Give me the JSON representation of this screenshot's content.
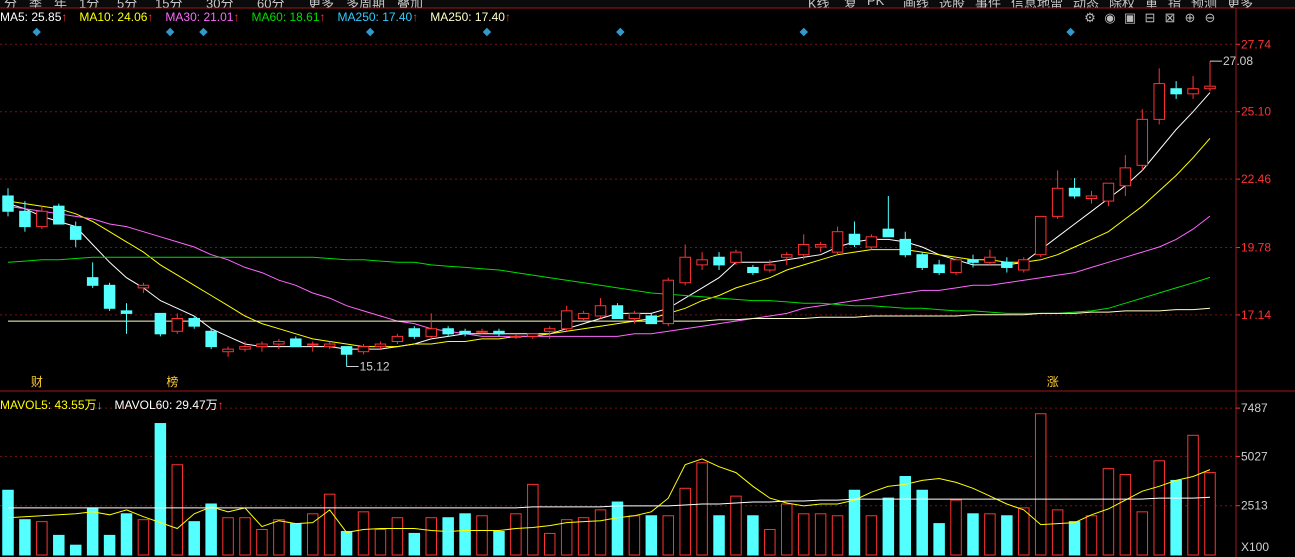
{
  "toolbar": {
    "left_items": [
      "分",
      "季",
      "年",
      "1分",
      "5分",
      "15分",
      "30分",
      "60分",
      "更多",
      "多周期",
      "叠加"
    ],
    "right_items": [
      "K线",
      "复",
      "PK",
      "画线",
      "选股",
      "事件",
      "信息地雷",
      "动态",
      "除权",
      "重",
      "指",
      "预测",
      "更多"
    ]
  },
  "ma_legend": [
    {
      "label": "MA5: 25.85",
      "arrow": "↑",
      "color": "#ffffff"
    },
    {
      "label": "MA10: 24.06",
      "arrow": "↑",
      "color": "#ffff00"
    },
    {
      "label": "MA30: 21.01",
      "arrow": "↑",
      "color": "#ff66ff"
    },
    {
      "label": "MA60: 18.61",
      "arrow": "↑",
      "color": "#00dd00"
    },
    {
      "label": "MA250: 17.40",
      "arrow": "↑",
      "color": "#33ccff"
    },
    {
      "label": "MA250: 17.40",
      "arrow": "↑",
      "color": "#ffffc8"
    }
  ],
  "vol_legend": [
    {
      "label": "MAVOL5: 43.55万",
      "arrow": "↓",
      "color": "#ffff00",
      "arrow_color": "#33ccff"
    },
    {
      "label": "MAVOL60: 29.47万",
      "arrow": "↑",
      "color": "#ffffff",
      "arrow_color": "#ff3232"
    }
  ],
  "icons": [
    "settings-icon",
    "eye-icon",
    "lock-icon",
    "bag-icon",
    "trash-icon",
    "zoom-in-icon",
    "zoom-out-icon"
  ],
  "colors": {
    "up": "#ff3232",
    "down": "#54ffff",
    "grid": "#7a1212",
    "axis_text": "#ff3232"
  },
  "chart_data": [
    {
      "type": "candlestick",
      "yticks": [
        "27.74",
        "25.10",
        "22.46",
        "19.78",
        "17.14"
      ],
      "ylim": [
        14.2,
        28.3
      ],
      "grid": true,
      "annotations": {
        "high": {
          "text": "27.08",
          "index": 71
        },
        "low": {
          "text": "15.12",
          "index": 20
        },
        "markers": [
          {
            "text": "财",
            "index": 1
          },
          {
            "text": "榜",
            "index": 9
          },
          {
            "text": "涨",
            "index": 61
          }
        ],
        "event_diamonds": [
          1,
          9,
          11,
          21,
          28,
          36,
          47,
          63
        ]
      },
      "ohlc": [
        [
          21.8,
          22.1,
          21.0,
          21.2
        ],
        [
          21.2,
          21.6,
          20.4,
          20.6
        ],
        [
          20.6,
          21.4,
          20.5,
          21.2
        ],
        [
          21.4,
          21.5,
          20.7,
          20.7
        ],
        [
          20.6,
          20.8,
          19.8,
          20.1
        ],
        [
          18.6,
          19.2,
          18.2,
          18.3
        ],
        [
          18.3,
          18.4,
          17.3,
          17.4
        ],
        [
          17.3,
          17.6,
          16.4,
          17.2
        ],
        [
          18.2,
          18.4,
          18.0,
          18.3
        ],
        [
          17.2,
          17.2,
          16.3,
          16.4
        ],
        [
          16.5,
          17.2,
          16.4,
          17.0
        ],
        [
          17.0,
          17.1,
          16.6,
          16.7
        ],
        [
          16.5,
          16.6,
          15.8,
          15.9
        ],
        [
          15.7,
          15.9,
          15.5,
          15.8
        ],
        [
          15.8,
          16.1,
          15.7,
          15.9
        ],
        [
          15.9,
          16.1,
          15.7,
          16.0
        ],
        [
          16.0,
          16.2,
          15.8,
          16.1
        ],
        [
          16.2,
          16.3,
          15.9,
          15.9
        ],
        [
          16.0,
          16.1,
          15.7,
          16.0
        ],
        [
          15.9,
          16.1,
          15.8,
          16.0
        ],
        [
          15.9,
          15.9,
          15.12,
          15.6
        ],
        [
          15.7,
          16.0,
          15.6,
          15.9
        ],
        [
          15.9,
          16.1,
          15.8,
          16.0
        ],
        [
          16.1,
          16.4,
          16.0,
          16.3
        ],
        [
          16.6,
          16.7,
          16.2,
          16.3
        ],
        [
          16.3,
          17.2,
          16.2,
          16.6
        ],
        [
          16.6,
          16.7,
          16.3,
          16.4
        ],
        [
          16.5,
          16.6,
          16.3,
          16.4
        ],
        [
          16.5,
          16.6,
          16.4,
          16.5
        ],
        [
          16.5,
          16.6,
          16.3,
          16.4
        ],
        [
          16.3,
          16.4,
          16.2,
          16.3
        ],
        [
          16.3,
          16.4,
          16.2,
          16.4
        ],
        [
          16.5,
          16.7,
          16.2,
          16.6
        ],
        [
          16.6,
          17.5,
          16.5,
          17.3
        ],
        [
          17.0,
          17.3,
          16.9,
          17.2
        ],
        [
          17.1,
          17.8,
          17.0,
          17.5
        ],
        [
          17.5,
          17.6,
          17.0,
          17.0
        ],
        [
          17.0,
          17.3,
          16.8,
          17.2
        ],
        [
          17.1,
          17.2,
          16.8,
          16.8
        ],
        [
          16.8,
          18.6,
          16.7,
          18.5
        ],
        [
          18.4,
          19.9,
          18.3,
          19.4
        ],
        [
          19.1,
          19.6,
          18.9,
          19.3
        ],
        [
          19.4,
          19.6,
          18.9,
          19.1
        ],
        [
          19.2,
          19.7,
          19.1,
          19.6
        ],
        [
          19.0,
          19.1,
          18.7,
          18.8
        ],
        [
          18.9,
          19.3,
          18.8,
          19.1
        ],
        [
          19.4,
          19.6,
          19.1,
          19.5
        ],
        [
          19.5,
          20.3,
          19.3,
          19.9
        ],
        [
          19.8,
          20.0,
          19.6,
          19.9
        ],
        [
          19.6,
          20.6,
          19.5,
          20.4
        ],
        [
          20.3,
          20.8,
          19.8,
          19.9
        ],
        [
          19.8,
          20.3,
          19.7,
          20.2
        ],
        [
          20.5,
          21.8,
          20.2,
          20.2
        ],
        [
          20.1,
          20.4,
          19.4,
          19.5
        ],
        [
          19.5,
          19.6,
          18.9,
          19.0
        ],
        [
          19.1,
          19.3,
          18.7,
          18.8
        ],
        [
          18.8,
          19.4,
          18.7,
          19.3
        ],
        [
          19.3,
          19.5,
          19.0,
          19.2
        ],
        [
          19.2,
          19.7,
          19.1,
          19.4
        ],
        [
          19.2,
          19.4,
          18.8,
          19.0
        ],
        [
          18.9,
          19.4,
          18.8,
          19.3
        ],
        [
          19.5,
          21.0,
          19.4,
          21.0
        ],
        [
          21.0,
          22.8,
          20.9,
          22.1
        ],
        [
          22.1,
          22.5,
          21.7,
          21.8
        ],
        [
          21.7,
          22.0,
          21.5,
          21.8
        ],
        [
          21.6,
          22.3,
          21.4,
          22.3
        ],
        [
          22.2,
          23.4,
          21.8,
          22.9
        ],
        [
          23.0,
          25.2,
          22.8,
          24.8
        ],
        [
          24.8,
          26.8,
          24.6,
          26.2
        ],
        [
          26.0,
          26.3,
          25.6,
          25.8
        ],
        [
          25.8,
          26.5,
          25.6,
          26.0
        ],
        [
          26.0,
          27.08,
          25.9,
          26.1
        ]
      ],
      "ma": {
        "MA5": [
          21.5,
          21.3,
          21.0,
          20.8,
          20.6,
          19.9,
          19.2,
          18.6,
          18.2,
          17.7,
          17.4,
          17.1,
          16.6,
          16.3,
          16.0,
          15.9,
          15.9,
          15.9,
          15.9,
          15.9,
          15.8,
          15.8,
          15.8,
          15.9,
          16.0,
          16.2,
          16.3,
          16.4,
          16.4,
          16.4,
          16.4,
          16.4,
          16.4,
          16.6,
          16.8,
          17.0,
          17.2,
          17.2,
          17.2,
          17.4,
          17.8,
          18.2,
          18.6,
          19.2,
          19.2,
          19.2,
          19.3,
          19.4,
          19.5,
          19.8,
          20.0,
          20.1,
          20.1,
          20.0,
          19.8,
          19.5,
          19.3,
          19.1,
          19.1,
          19.1,
          19.2,
          19.7,
          20.2,
          20.7,
          21.2,
          21.7,
          22.2,
          22.8,
          23.6,
          24.4,
          25.1,
          25.85
        ],
        "MA10": [
          21.6,
          21.5,
          21.4,
          21.3,
          21.1,
          20.8,
          20.4,
          20.0,
          19.6,
          19.1,
          18.7,
          18.3,
          17.9,
          17.5,
          17.1,
          16.8,
          16.6,
          16.4,
          16.2,
          16.1,
          16.0,
          15.9,
          15.9,
          15.9,
          16.0,
          16.0,
          16.1,
          16.1,
          16.2,
          16.2,
          16.3,
          16.3,
          16.4,
          16.5,
          16.6,
          16.7,
          16.8,
          16.9,
          17.0,
          17.2,
          17.4,
          17.7,
          17.9,
          18.2,
          18.4,
          18.6,
          18.9,
          19.1,
          19.3,
          19.5,
          19.6,
          19.7,
          19.7,
          19.7,
          19.6,
          19.5,
          19.4,
          19.3,
          19.3,
          19.2,
          19.2,
          19.3,
          19.5,
          19.8,
          20.1,
          20.4,
          20.9,
          21.4,
          22.0,
          22.6,
          23.3,
          24.06
        ],
        "MA30": [
          21.4,
          21.3,
          21.2,
          21.1,
          21.0,
          20.9,
          20.7,
          20.6,
          20.4,
          20.2,
          20.0,
          19.8,
          19.5,
          19.3,
          19.0,
          18.8,
          18.5,
          18.3,
          18.0,
          17.8,
          17.5,
          17.3,
          17.1,
          16.9,
          16.8,
          16.6,
          16.5,
          16.4,
          16.3,
          16.3,
          16.3,
          16.3,
          16.3,
          16.3,
          16.3,
          16.3,
          16.3,
          16.4,
          16.4,
          16.5,
          16.6,
          16.7,
          16.8,
          16.9,
          17.0,
          17.1,
          17.2,
          17.4,
          17.5,
          17.6,
          17.7,
          17.8,
          17.9,
          18.0,
          18.1,
          18.1,
          18.2,
          18.3,
          18.3,
          18.4,
          18.5,
          18.6,
          18.7,
          18.8,
          19.0,
          19.2,
          19.4,
          19.6,
          19.8,
          20.1,
          20.5,
          21.01
        ],
        "MA60": [
          19.2,
          19.25,
          19.3,
          19.3,
          19.35,
          19.4,
          19.4,
          19.4,
          19.4,
          19.4,
          19.4,
          19.4,
          19.4,
          19.4,
          19.4,
          19.4,
          19.4,
          19.4,
          19.4,
          19.35,
          19.3,
          19.3,
          19.25,
          19.2,
          19.2,
          19.1,
          19.05,
          19.0,
          18.95,
          18.9,
          18.8,
          18.7,
          18.6,
          18.5,
          18.4,
          18.3,
          18.2,
          18.1,
          18.0,
          17.95,
          17.9,
          17.85,
          17.8,
          17.75,
          17.7,
          17.7,
          17.65,
          17.6,
          17.6,
          17.55,
          17.5,
          17.5,
          17.45,
          17.4,
          17.4,
          17.35,
          17.3,
          17.3,
          17.25,
          17.2,
          17.2,
          17.2,
          17.2,
          17.25,
          17.3,
          17.4,
          17.6,
          17.8,
          18.0,
          18.2,
          18.4,
          18.61
        ],
        "MA250": [
          16.9,
          16.9,
          16.9,
          16.9,
          16.9,
          16.9,
          16.9,
          16.9,
          16.9,
          16.9,
          16.9,
          16.9,
          16.9,
          16.9,
          16.9,
          16.9,
          16.9,
          16.9,
          16.9,
          16.9,
          16.9,
          16.9,
          16.9,
          16.9,
          16.9,
          16.9,
          16.9,
          16.9,
          16.9,
          16.9,
          16.9,
          16.9,
          16.9,
          16.9,
          16.9,
          16.9,
          16.9,
          16.9,
          16.9,
          16.9,
          16.9,
          16.9,
          16.95,
          16.95,
          17.0,
          17.0,
          17.0,
          17.0,
          17.05,
          17.05,
          17.05,
          17.1,
          17.1,
          17.1,
          17.1,
          17.1,
          17.1,
          17.15,
          17.15,
          17.15,
          17.15,
          17.2,
          17.2,
          17.2,
          17.25,
          17.25,
          17.3,
          17.3,
          17.3,
          17.35,
          17.35,
          17.4
        ]
      }
    },
    {
      "type": "bar",
      "yticks": [
        "7487",
        "5027",
        "2513"
      ],
      "unit": "X100",
      "ylim": [
        0,
        7900
      ],
      "volume": [
        3300,
        1800,
        1700,
        1000,
        500,
        2400,
        1000,
        2100,
        1800,
        6700,
        4600,
        1700,
        2600,
        1900,
        1900,
        1300,
        1800,
        1600,
        2100,
        3100,
        1200,
        2200,
        1300,
        1900,
        1100,
        1900,
        1900,
        2100,
        2000,
        1200,
        2100,
        3600,
        1100,
        1800,
        1900,
        2300,
        2700,
        2000,
        2000,
        2000,
        3400,
        4700,
        2000,
        3000,
        2000,
        1300,
        2600,
        2100,
        2100,
        2000,
        3300,
        2000,
        2900,
        4000,
        3300,
        1600,
        2800,
        2100,
        2100,
        2000,
        2400,
        7200,
        2300,
        1700,
        2000,
        4400,
        4100,
        2200,
        4800,
        3800,
        6100,
        4200
      ],
      "mavol5": [
        1900,
        1950,
        2000,
        2050,
        2100,
        2200,
        2050,
        2300,
        1950,
        1650,
        1350,
        2100,
        2450,
        2200,
        2400,
        1450,
        1750,
        1600,
        1650,
        2300,
        1150,
        1300,
        1350,
        1350,
        1350,
        1250,
        1200,
        1250,
        1250,
        1250,
        1350,
        1400,
        1500,
        1650,
        1700,
        1750,
        1900,
        2000,
        2200,
        2900,
        4600,
        4900,
        4500,
        4200,
        3500,
        2900,
        2650,
        2500,
        2600,
        2600,
        2800,
        3200,
        3500,
        3600,
        3800,
        3900,
        3700,
        3400,
        3000,
        2600,
        2300,
        1550,
        1600,
        1650,
        2050,
        2350,
        2800,
        3250,
        3500,
        3800,
        4000,
        4355
      ],
      "mavol60": [
        2400,
        2400,
        2400,
        2400,
        2400,
        2400,
        2400,
        2400,
        2400,
        2400,
        2400,
        2400,
        2400,
        2400,
        2400,
        2400,
        2400,
        2400,
        2400,
        2400,
        2400,
        2400,
        2400,
        2400,
        2400,
        2400,
        2400,
        2400,
        2400,
        2400,
        2400,
        2450,
        2450,
        2450,
        2450,
        2450,
        2500,
        2500,
        2500,
        2500,
        2550,
        2600,
        2600,
        2650,
        2700,
        2700,
        2750,
        2750,
        2800,
        2800,
        2850,
        2850,
        2850,
        2850,
        2850,
        2850,
        2850,
        2850,
        2850,
        2850,
        2850,
        2850,
        2850,
        2850,
        2850,
        2850,
        2850,
        2850,
        2900,
        2900,
        2900,
        2947
      ]
    }
  ]
}
